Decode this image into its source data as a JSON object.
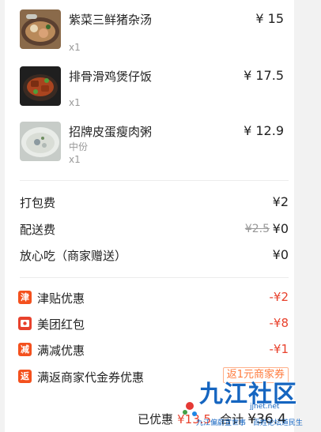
{
  "items": [
    {
      "name": "紫菜三鲜猪杂汤",
      "price": "¥ 15",
      "spec": "",
      "qty": "x1"
    },
    {
      "name": "排骨滑鸡煲仔饭",
      "price": "¥ 17.5",
      "spec": "",
      "qty": "x1"
    },
    {
      "name": "招牌皮蛋瘦肉粥",
      "price": "¥ 12.9",
      "spec": "中份",
      "qty": "x1"
    }
  ],
  "fees": {
    "packaging": {
      "label": "打包费",
      "value": "¥2"
    },
    "delivery": {
      "label": "配送费",
      "original": "¥2.5",
      "value": "¥0"
    },
    "assurance": {
      "label": "放心吃（商家赠送）",
      "value": "¥0"
    }
  },
  "discounts": [
    {
      "icon_text": "津",
      "icon_color": "#f4511e",
      "label": "津贴优惠",
      "value": "-¥2"
    },
    {
      "icon_text": "",
      "icon_color": "#e8412c",
      "label": "美团红包",
      "value": "-¥8"
    },
    {
      "icon_text": "减",
      "icon_color": "#f4511e",
      "label": "满减优惠",
      "value": "-¥1"
    },
    {
      "icon_text": "返",
      "icon_color": "#f4511e",
      "label": "满返商家代金券优惠",
      "tag": "返1元商家券"
    }
  ],
  "summary": {
    "saved_label": "已优惠",
    "saved_value": "¥13.5",
    "total_label": "合计",
    "total_value": "¥36.4"
  },
  "watermark": {
    "title": "九江社区",
    "line1": "九江偏蔚宣世事",
    "line2": "百姓论坛道民生",
    "url": "jjnet.net"
  },
  "colors": {
    "accent_red": "#e8412c",
    "voucher_orange": "#ff7a3c"
  }
}
